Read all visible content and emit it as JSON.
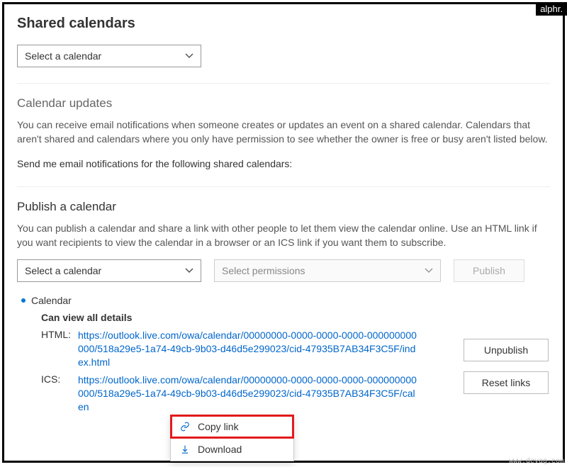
{
  "watermarks": {
    "topRight": "alphr.",
    "bottomRight": "www.devag.com"
  },
  "pageTitle": "Shared calendars",
  "topDropdown": {
    "label": "Select a calendar"
  },
  "updates": {
    "title": "Calendar updates",
    "desc": "You can receive email notifications when someone creates or updates an event on a shared calendar. Calendars that aren't shared and calendars where you only have permission to see whether the owner is free or busy aren't listed below.",
    "prompt": "Send me email notifications for the following shared calendars:"
  },
  "publish": {
    "title": "Publish a calendar",
    "desc": "You can publish a calendar and share a link with other people to let them view the calendar online. Use an HTML link if you want recipients to view the calendar in a browser or an ICS link if you want them to subscribe.",
    "calendarDropdown": "Select a calendar",
    "permDropdown": "Select permissions",
    "publishBtn": "Publish"
  },
  "entry": {
    "name": "Calendar",
    "permission": "Can view all details",
    "htmlLabel": "HTML:",
    "icsLabel": "ICS:",
    "htmlLink": "https://outlook.live.com/owa/calendar/00000000-0000-0000-0000-000000000000/518a29e5-1a74-49cb-9b03-d46d5e299023/cid-47935B7AB34F3C5F/index.html",
    "icsLink": "https://outlook.live.com/owa/calendar/00000000-0000-0000-0000-000000000000/518a29e5-1a74-49cb-9b03-d46d5e299023/cid-47935B7AB34F3C5F/calen",
    "unpublish": "Unpublish",
    "reset": "Reset links"
  },
  "menu": {
    "copy": "Copy link",
    "download": "Download"
  }
}
